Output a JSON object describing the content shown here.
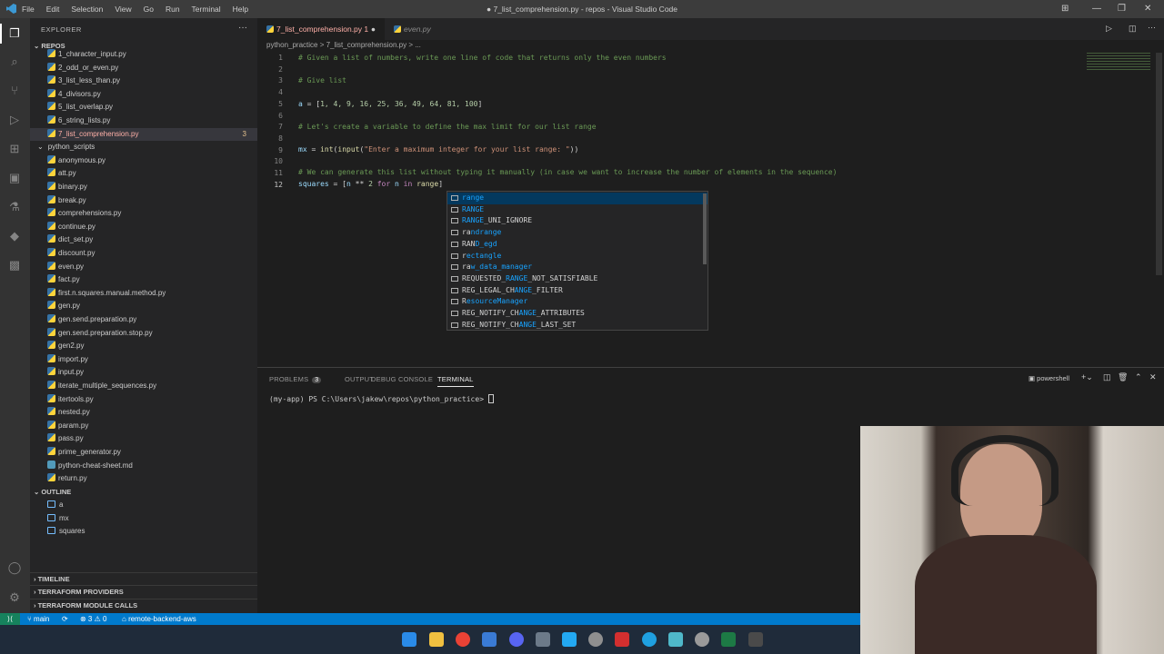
{
  "window": {
    "title": "● 7_list_comprehension.py - repos - Visual Studio Code",
    "menu": [
      "File",
      "Edit",
      "Selection",
      "View",
      "Go",
      "Run",
      "Terminal",
      "Help"
    ]
  },
  "sidebar": {
    "header": "EXPLORER",
    "root": "REPOS",
    "files_top": [
      {
        "name": "1_character_input.py"
      },
      {
        "name": "2_odd_or_even.py"
      },
      {
        "name": "3_list_less_than.py"
      },
      {
        "name": "4_divisors.py"
      },
      {
        "name": "5_list_overlap.py"
      },
      {
        "name": "6_string_lists.py"
      },
      {
        "name": "7_list_comprehension.py",
        "badge": "3"
      }
    ],
    "folder": "python_scripts",
    "files": [
      "anonymous.py",
      "att.py",
      "binary.py",
      "break.py",
      "comprehensions.py",
      "continue.py",
      "dict_set.py",
      "discount.py",
      "even.py",
      "fact.py",
      "first.n.squares.manual.method.py",
      "gen.py",
      "gen.send.preparation.py",
      "gen.send.preparation.stop.py",
      "gen2.py",
      "import.py",
      "input.py",
      "iterate_multiple_sequences.py",
      "itertools.py",
      "nested.py",
      "param.py",
      "pass.py",
      "prime_generator.py",
      "python-cheat-sheet.md",
      "return.py"
    ],
    "outline_title": "OUTLINE",
    "outline": [
      "a",
      "mx",
      "squares"
    ],
    "sections": [
      "TIMELINE",
      "TERRAFORM PROVIDERS",
      "TERRAFORM MODULE CALLS"
    ]
  },
  "tabs": [
    {
      "label": "7_list_comprehension.py",
      "badge": "1",
      "dirty": "●"
    },
    {
      "label": "even.py"
    }
  ],
  "breadcrumb": "python_practice  >  7_list_comprehension.py  >  ...",
  "editor": {
    "lines": [
      "1",
      "2",
      "3",
      "4",
      "5",
      "6",
      "7",
      "8",
      "9",
      "10",
      "11",
      "12"
    ],
    "code": {
      "l1": "# Given a list of numbers, write one line of code that returns only the even numbers",
      "l3": "# Give list",
      "l5a": "a",
      "l5b": " = [",
      "l5c": "1, 4, 9, 16, 25, 36, 49, 64, 81, 100",
      "l5d": "]",
      "l7": "# Let's create a variable to define the max limit for our list range",
      "l9a": "mx",
      "l9b": " = ",
      "l9c": "int",
      "l9d": "(",
      "l9e": "input",
      "l9f": "(",
      "l9g": "\"Enter a maximum integer for your list range: \"",
      "l9h": "))",
      "l11": "# We can generate this list without typing it manually (in case we want to increase the number of elements in the sequence)",
      "l12a": "squares",
      "l12b": " = [",
      "l12c": "n",
      "l12d": " ** ",
      "l12e": "2",
      "l12f": " for ",
      "l12g": "n",
      "l12h": " in ",
      "l12i": "range",
      "l12j": "]"
    }
  },
  "suggestions": [
    {
      "label": "range",
      "match": "range",
      "rest": ""
    },
    {
      "label": "RANGE",
      "match": "RANGE",
      "rest": ""
    },
    {
      "label": "RANGE_UNI_IGNORE",
      "match": "RANGE",
      "rest": "_UNI_IGNORE"
    },
    {
      "label": "randrange",
      "pre": "ra",
      "match": "ndrange",
      "rest": ""
    },
    {
      "label": "RAND_egd",
      "pre": "RAN",
      "match": "D_egd",
      "rest": ""
    },
    {
      "label": "rectangle",
      "pre": "r",
      "match": "ectangle",
      "rest": ""
    },
    {
      "label": "raw_data_manager",
      "pre": "ra",
      "match": "w_data_manager",
      "rest": ""
    },
    {
      "label": "REQUESTED_RANGE_NOT_SATISFIABLE",
      "pre": "REQUESTED_",
      "match": "RANGE",
      "rest": "_NOT_SATISFIABLE"
    },
    {
      "label": "REG_LEGAL_CHANGE_FILTER",
      "pre": "REG_LEGAL_CH",
      "match": "ANGE",
      "rest": "_FILTER"
    },
    {
      "label": "ResourceManager",
      "pre": "R",
      "match": "esourceManager",
      "rest": ""
    },
    {
      "label": "REG_NOTIFY_CHANGE_ATTRIBUTES",
      "pre": "REG_NOTIFY_CH",
      "match": "ANGE",
      "rest": "_ATTRIBUTES"
    },
    {
      "label": "REG_NOTIFY_CHANGE_LAST_SET",
      "pre": "REG_NOTIFY_CH",
      "match": "ANGE",
      "rest": "_LAST_SET"
    }
  ],
  "panel": {
    "tabs": [
      "PROBLEMS",
      "OUTPUT",
      "DEBUG CONSOLE",
      "TERMINAL"
    ],
    "problems_count": "3",
    "shell": "powershell",
    "prompt": "(my-app) PS C:\\Users\\jakew\\repos\\python_practice> "
  },
  "status": {
    "branch": "main",
    "errors": "⊗ 3 ⚠ 0",
    "remote": "remote-backend-aws"
  },
  "colors": {
    "accent": "#007acc",
    "activity_bar": "#333333",
    "sidebar": "#252526",
    "editor": "#1e1e1e"
  }
}
